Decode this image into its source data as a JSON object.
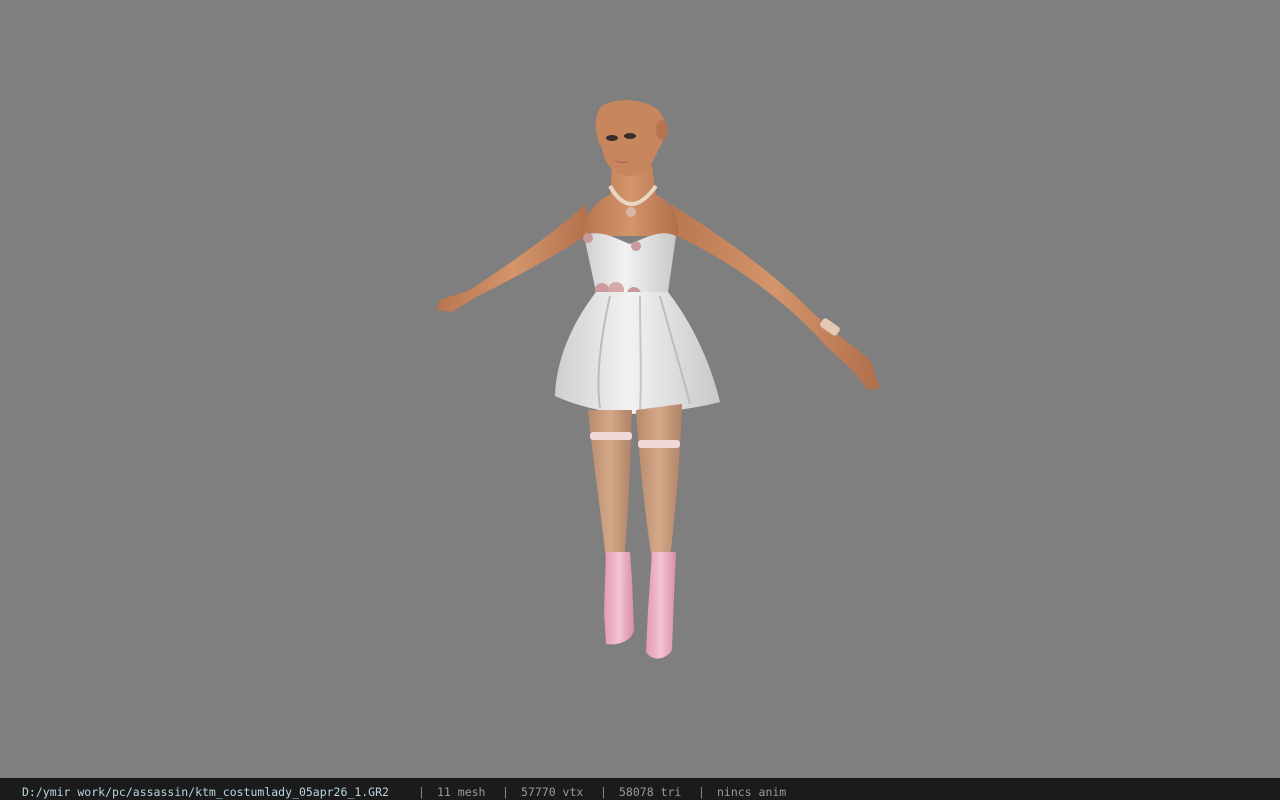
{
  "viewport": {
    "background": "#7f7f7f",
    "model_name": "3d-character-model"
  },
  "statusbar": {
    "file_path": "D:/ymir work/pc/assassin/ktm_costumlady_05apr26_1.GR2",
    "separator": "|",
    "mesh": "11 mesh",
    "vtx": "57770 vtx",
    "tri": "58078 tri",
    "anim": "nincs anim"
  },
  "colors": {
    "skin": "#c9875f",
    "dress": "#e6e6e6",
    "shoes": "#e8a9bd",
    "statusbar_bg": "#1b1b1b",
    "path_text": "#b6d6e0"
  }
}
